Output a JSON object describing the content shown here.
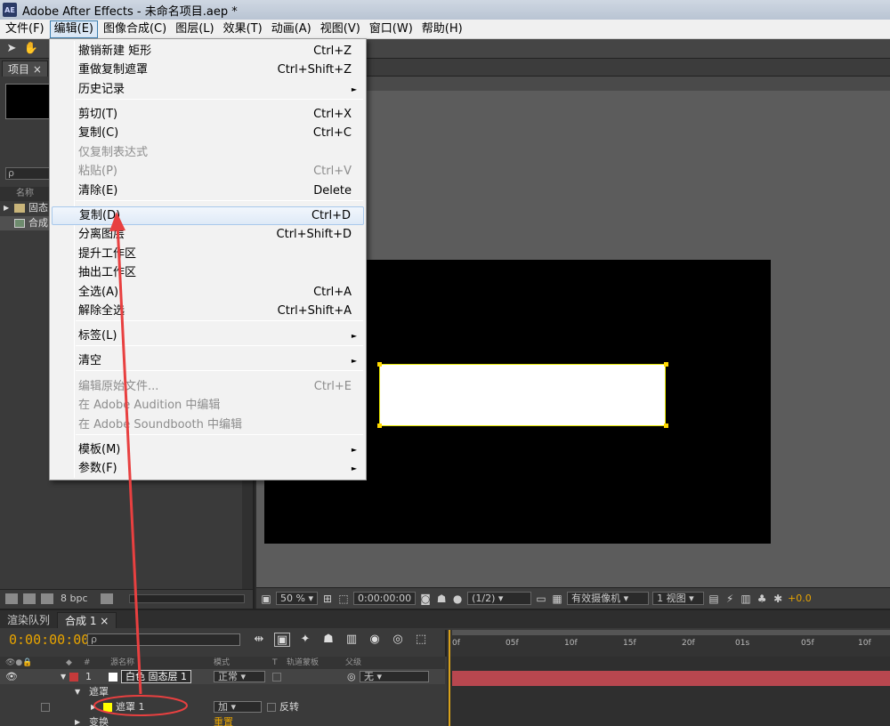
{
  "window": {
    "title": "Adobe After Effects - 未命名项目.aep *",
    "logo": "AE"
  },
  "menubar": [
    {
      "label": "文件(F)"
    },
    {
      "label": "编辑(E)",
      "active": true
    },
    {
      "label": "图像合成(C)"
    },
    {
      "label": "图层(L)"
    },
    {
      "label": "效果(T)"
    },
    {
      "label": "动画(A)"
    },
    {
      "label": "视图(V)"
    },
    {
      "label": "窗口(W)"
    },
    {
      "label": "帮助(H)"
    }
  ],
  "edit_menu": {
    "items": [
      {
        "label": "撤销新建 矩形",
        "shortcut": "Ctrl+Z"
      },
      {
        "label": "重做复制遮罩",
        "shortcut": "Ctrl+Shift+Z"
      },
      {
        "label": "历史记录",
        "submenu": true
      },
      {
        "label": "剪切(T)",
        "shortcut": "Ctrl+X"
      },
      {
        "label": "复制(C)",
        "shortcut": "Ctrl+C"
      },
      {
        "label": "仅复制表达式",
        "disabled": true
      },
      {
        "label": "粘贴(P)",
        "shortcut": "Ctrl+V",
        "disabled": true
      },
      {
        "label": "清除(E)",
        "shortcut": "Delete"
      },
      {
        "label": "复制(D)",
        "shortcut": "Ctrl+D",
        "highlighted": true
      },
      {
        "label": "分离图层",
        "shortcut": "Ctrl+Shift+D"
      },
      {
        "label": "提升工作区"
      },
      {
        "label": "抽出工作区"
      },
      {
        "label": "全选(A)",
        "shortcut": "Ctrl+A"
      },
      {
        "label": "解除全选",
        "shortcut": "Ctrl+Shift+A"
      },
      {
        "label": "标签(L)",
        "submenu": true
      },
      {
        "label": "清空",
        "submenu": true
      },
      {
        "label": "编辑原始文件...",
        "shortcut": "Ctrl+E",
        "disabled": true
      },
      {
        "label": "在 Adobe Audition 中编辑",
        "disabled": true
      },
      {
        "label": "在 Adobe Soundbooth 中编辑",
        "disabled": true
      },
      {
        "label": "模板(M)",
        "submenu": true
      },
      {
        "label": "参数(F)",
        "submenu": true
      }
    ],
    "submenu_arrow": "►"
  },
  "project_panel": {
    "tab": "项目",
    "column_name": "名称",
    "rows": [
      {
        "label": "固态",
        "icon": "folder-icon"
      },
      {
        "label": "合成",
        "icon": "composition-icon",
        "selected": true
      }
    ],
    "bpc": "8 bpc"
  },
  "viewer": {
    "zoom": "50 %",
    "timecode": "0:00:00:00",
    "resolution": "(1/2)",
    "camera": "有效摄像机",
    "views": "1 视图",
    "exposure": "+0.0",
    "colors": {
      "canvas": "#000000",
      "mask_stroke": "#e6e600",
      "handle": "#ffd800"
    }
  },
  "timeline": {
    "tabs": [
      {
        "label": "渲染队列"
      },
      {
        "label": "合成 1"
      }
    ],
    "timecode": "0:00:00:00",
    "search_placeholder": "ρ",
    "columns": {
      "layer_name": "源名称",
      "mode": "模式",
      "t": "T",
      "track_matte": "轨道蒙板",
      "parent": "父级"
    },
    "layer": {
      "number": "1",
      "name": "白色 固态层 1",
      "mode": "正常",
      "parent": "无",
      "color": "#c53a3a",
      "swatch": "#ffffff"
    },
    "masks_group": "遮罩",
    "mask": {
      "name": "遮罩 1",
      "mode": "加",
      "invert": "反转",
      "color": "#ffff00"
    },
    "transform_group": "变换",
    "transform_value": "重置",
    "ruler": [
      "0f",
      "05f",
      "10f",
      "15f",
      "20f",
      "01s",
      "05f",
      "10f"
    ],
    "bar_color": "#b8474f"
  },
  "annotation": {
    "color": "#e84040"
  }
}
